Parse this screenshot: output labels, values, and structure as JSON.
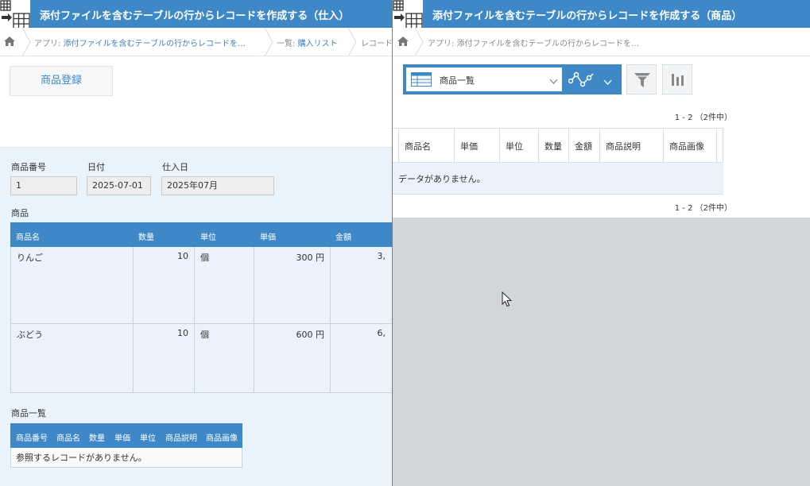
{
  "left": {
    "title": "添付ファイルを含むテーブルの行からレコードを作成する（仕入）",
    "breadcrumb": {
      "app_prefix": "アプリ: ",
      "app_link": "添付ファイルを含むテーブルの行からレコードを…",
      "list_prefix": "一覧: ",
      "list_link": "購入リスト",
      "record": "レコード"
    },
    "register_button": "商品登録",
    "fields": {
      "product_no_label": "商品番号",
      "product_no_value": "1",
      "date_label": "日付",
      "date_value": "2025-07-01",
      "purchase_date_label": "仕入日",
      "purchase_date_value": "2025年07月"
    },
    "subtable_label": "商品",
    "subtable": {
      "headers": [
        "商品名",
        "数量",
        "単位",
        "単価",
        "金額"
      ],
      "rows": [
        {
          "name": "りんご",
          "qty": "10",
          "unit": "個",
          "price": "300 円",
          "amount": "3,"
        },
        {
          "name": "ぶどう",
          "qty": "10",
          "unit": "個",
          "price": "600 円",
          "amount": "6,"
        }
      ]
    },
    "ref_label": "商品一覧",
    "ref_table": {
      "headers": [
        "商品番号",
        "商品名",
        "数量",
        "単価",
        "単位",
        "商品説明",
        "商品画像"
      ],
      "empty": "参照するレコードがありません。"
    }
  },
  "right": {
    "title": "添付ファイルを含むテーブルの行からレコードを作成する（商品）",
    "breadcrumb": {
      "app_prefix": "アプリ: ",
      "app_name": "添付ファイルを含むテーブルの行からレコードを…"
    },
    "view_name": "商品一覧",
    "pager_top": "1 - 2 （2件中）",
    "pager_bottom": "1 - 2 （2件中）",
    "columns": [
      "商品名",
      "単価",
      "単位",
      "数量",
      "金額",
      "商品説明",
      "商品画像"
    ],
    "empty_message": "データがありません。"
  },
  "colors": {
    "accent": "#3f88c7",
    "row_bg": "#eaf3fb",
    "gray_bg": "#d3d6d8"
  }
}
